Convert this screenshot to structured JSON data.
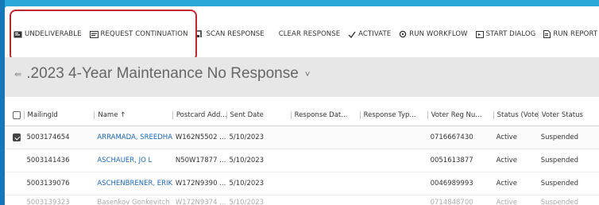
{
  "toolbar": {
    "items": [
      {
        "label": "UNDELIVERABLE",
        "icon": "undeliverable-icon"
      },
      {
        "label": "REQUEST CONTINUATION",
        "icon": "request-icon"
      },
      {
        "label": "SCAN RESPONSE",
        "icon": "scan-icon"
      },
      {
        "label": "CLEAR RESPONSE",
        "icon": ""
      },
      {
        "label": "ACTIVATE",
        "icon": "check-icon"
      },
      {
        "label": "RUN WORKFLOW",
        "icon": "workflow-icon"
      },
      {
        "label": "START DIALOG",
        "icon": "dialog-icon"
      },
      {
        "label": "RUN REPORT",
        "icon": "report-icon"
      },
      {
        "more": "▾"
      }
    ],
    "highlight_color": "#c0262d"
  },
  "view": {
    "pin_glyph": "⇚",
    "title": ".2023 4-Year Maintenance No Response",
    "chevron": "˅"
  },
  "grid": {
    "columns": [
      "MailingId",
      "Name ↑",
      "Postcard Add...",
      "Sent Date",
      "Response Dat...",
      "Response Typ...",
      "Voter Reg Nu...",
      "Status (Voter)...",
      "Voter Status"
    ],
    "rows": [
      {
        "checked": true,
        "cells": [
          "5003174654",
          "ARRAMADA, SREEDHAR",
          "W162N5502 ...",
          "5/10/2023",
          "",
          "",
          "0716667430",
          "Active",
          "Suspended"
        ]
      },
      {
        "checked": false,
        "cells": [
          "5003141436",
          "ASCHAUER, JO L",
          "N50W17877 ...",
          "5/10/2023",
          "",
          "",
          "0051613877",
          "Active",
          "Suspended"
        ]
      },
      {
        "checked": false,
        "cells": [
          "5003139076",
          "ASCHENBRENER, ERIK R",
          "W172N9390 ...",
          "5/10/2023",
          "",
          "",
          "0046989993",
          "Active",
          "Suspended"
        ]
      },
      {
        "checked": false,
        "cells": [
          "5003139323",
          "Basenkov Gonkevitch",
          "W172N9374 ...",
          "5/10/2023",
          "",
          "",
          "0714848700",
          "Active",
          "Suspended"
        ]
      }
    ]
  },
  "colors": {
    "link": "#1a67b8",
    "accent_top": "#2aa8d9"
  }
}
